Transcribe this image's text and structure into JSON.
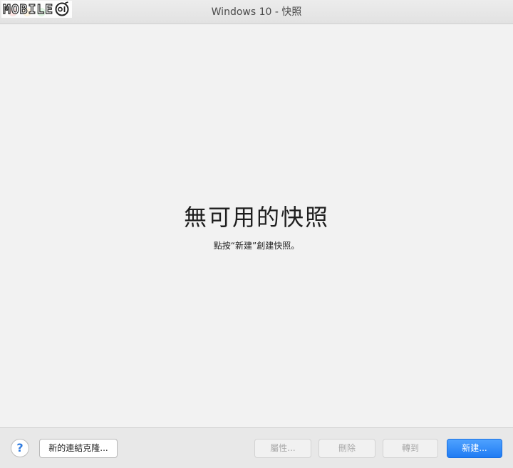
{
  "window": {
    "title": "Windows 10 - 快照"
  },
  "watermark": {
    "text": "MOBILE",
    "logo_icon": "mobile01-logo-icon"
  },
  "empty_state": {
    "title": "無可用的快照",
    "subtitle": "點按“新建”創建快照。"
  },
  "footer": {
    "help_label": "?",
    "clone_label": "新的連結克隆...",
    "properties_label": "屬性...",
    "delete_label": "刪除",
    "goto_label": "轉到",
    "create_label": "新建..."
  },
  "colors": {
    "close": "#fc605b",
    "minimize": "#fdbc40",
    "zoom": "#34c84a",
    "accent": "#1f7bf3"
  }
}
